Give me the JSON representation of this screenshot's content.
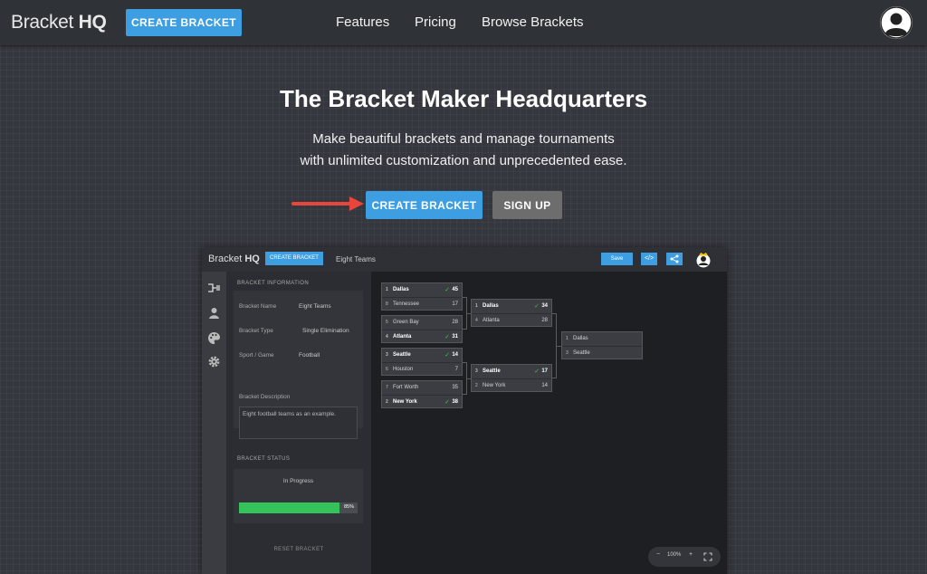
{
  "nav": {
    "logo_light": "Bracket ",
    "logo_bold": "HQ",
    "create_label": "CREATE BRACKET",
    "links": [
      "Features",
      "Pricing",
      "Browse Brackets"
    ]
  },
  "hero": {
    "title": "The Bracket Maker Headquarters",
    "subtitle_line1": "Make beautiful brackets and manage tournaments",
    "subtitle_line2": "with unlimited customization and unprecedented ease.",
    "create_label": "CREATE BRACKET",
    "signup_label": "SIGN UP"
  },
  "app": {
    "logo_light": "Bracket ",
    "logo_bold": "HQ",
    "create_label": "CREATE BRACKET",
    "title": "Eight Teams",
    "save_label": "Save",
    "embed_label": "</>",
    "panel": {
      "info_header": "BRACKET INFORMATION",
      "name_label": "Bracket Name",
      "name_value": "Eight Teams",
      "type_label": "Bracket Type",
      "type_value": "Single Elimination",
      "sport_label": "Sport / Game",
      "sport_value": "Football",
      "desc_label": "Bracket Description",
      "desc_value": "Eight football teams as an example.",
      "status_header": "BRACKET STATUS",
      "status_value": "In Progress",
      "progress": 0.85,
      "progress_label": "85%",
      "reset_label": "RESET BRACKET"
    },
    "rounds": [
      [
        {
          "a": {
            "seed": "1",
            "name": "Dallas",
            "score": "45",
            "win": true
          },
          "b": {
            "seed": "8",
            "name": "Tennessee",
            "score": "17",
            "win": false
          }
        },
        {
          "a": {
            "seed": "5",
            "name": "Green Bay",
            "score": "28",
            "win": false
          },
          "b": {
            "seed": "4",
            "name": "Atlanta",
            "score": "31",
            "win": true
          }
        },
        {
          "a": {
            "seed": "3",
            "name": "Seattle",
            "score": "14",
            "win": true
          },
          "b": {
            "seed": "6",
            "name": "Houston",
            "score": "7",
            "win": false
          }
        },
        {
          "a": {
            "seed": "7",
            "name": "Fort Worth",
            "score": "35",
            "win": false
          },
          "b": {
            "seed": "2",
            "name": "New York",
            "score": "38",
            "win": true
          }
        }
      ],
      [
        {
          "a": {
            "seed": "1",
            "name": "Dallas",
            "score": "34",
            "win": true
          },
          "b": {
            "seed": "4",
            "name": "Atlanta",
            "score": "28",
            "win": false
          }
        },
        {
          "a": {
            "seed": "3",
            "name": "Seattle",
            "score": "17",
            "win": true
          },
          "b": {
            "seed": "2",
            "name": "New York",
            "score": "14",
            "win": false
          }
        }
      ],
      [
        {
          "a": {
            "seed": "1",
            "name": "Dallas",
            "score": "",
            "win": false
          },
          "b": {
            "seed": "3",
            "name": "Seattle",
            "score": "",
            "win": false
          }
        }
      ]
    ],
    "zoom": {
      "minus": "−",
      "level": "100%",
      "plus": "+"
    }
  },
  "colors": {
    "accent": "#3d9ee1",
    "progress": "#34c25b",
    "arrow": "#e8453c"
  },
  "icons": [
    "user-avatar-icon",
    "bracket-icon",
    "person-icon",
    "palette-icon",
    "gear-icon",
    "share-icon",
    "code-icon",
    "fullscreen-icon",
    "checkmark-icon",
    "arrow-right-icon"
  ]
}
